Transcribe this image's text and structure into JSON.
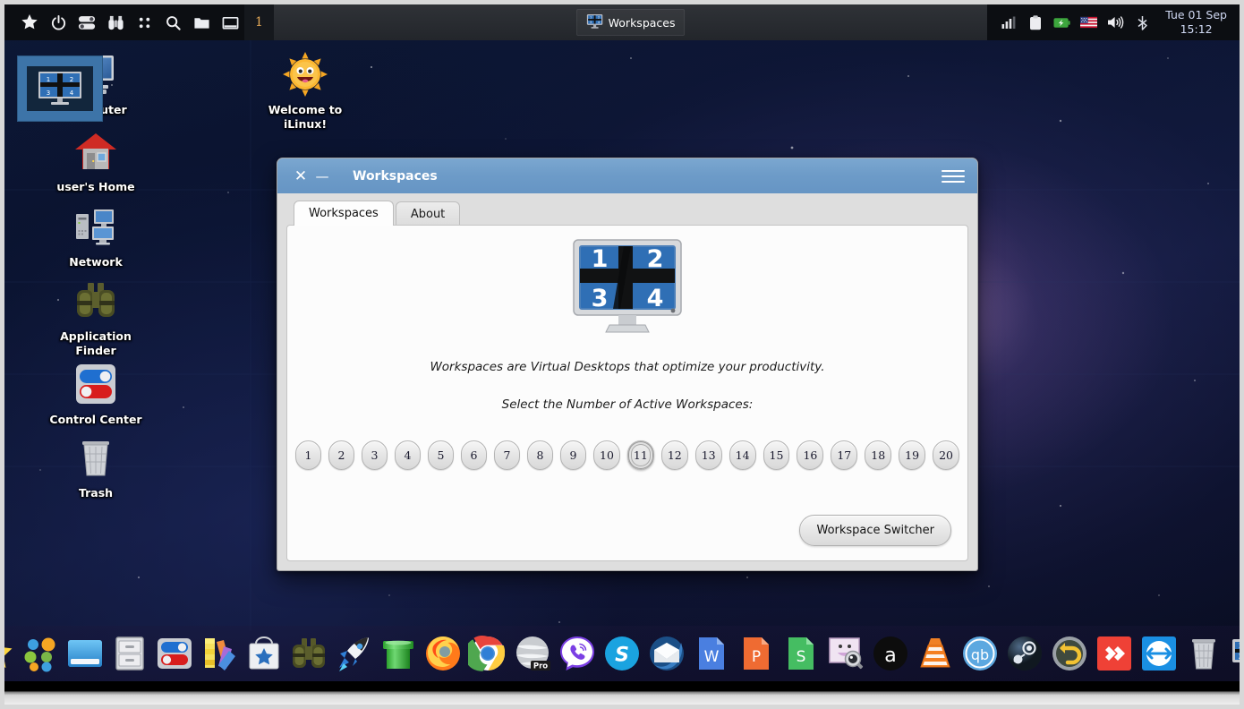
{
  "top_panel": {
    "launchers": [
      {
        "name": "whisker-star-icon",
        "label": "Applications"
      },
      {
        "name": "power-icon",
        "label": "Log Out"
      },
      {
        "name": "toggle-settings-icon",
        "label": "Settings"
      },
      {
        "name": "binoculars-icon",
        "label": "Application Finder"
      },
      {
        "name": "grid-dots-icon",
        "label": "Show Desktop"
      },
      {
        "name": "search-icon",
        "label": "Search"
      },
      {
        "name": "folder-icon",
        "label": "File Manager"
      },
      {
        "name": "window-icon",
        "label": "Terminal"
      }
    ],
    "workspace_number": "1",
    "task_button": {
      "label": "Workspaces",
      "icon": "workspaces-monitor-icon"
    },
    "tray": [
      {
        "name": "network-signal-icon"
      },
      {
        "name": "clipboard-icon"
      },
      {
        "name": "battery-icon"
      },
      {
        "name": "keyboard-flag-us-icon"
      },
      {
        "name": "volume-icon"
      },
      {
        "name": "bluetooth-icon"
      }
    ],
    "clock": {
      "date": "Tue 01 Sep",
      "time": "15:12"
    }
  },
  "desktop_icons": [
    {
      "name": "computer",
      "label": "Computer",
      "icon": "monitor-icon"
    },
    {
      "name": "welcome",
      "label": "Welcome to iLinux!",
      "icon": "sun-smile-icon"
    },
    {
      "name": "home",
      "label": "user's Home",
      "icon": "house-icon"
    },
    {
      "name": "network",
      "label": "Network",
      "icon": "network-computers-icon"
    },
    {
      "name": "appfinder",
      "label": "Application Finder",
      "icon": "binoculars-icon"
    },
    {
      "name": "control-center",
      "label": "Control Center",
      "icon": "toggles-icon"
    },
    {
      "name": "trash",
      "label": "Trash",
      "icon": "trash-bin-icon"
    }
  ],
  "window": {
    "title": "Workspaces",
    "close_label": "✕",
    "minimize_label": "—",
    "menu_label": "☰",
    "tabs": [
      {
        "label": "Workspaces",
        "active": true
      },
      {
        "label": "About",
        "active": false
      }
    ],
    "monitor_numbers": [
      "1",
      "2",
      "3",
      "4"
    ],
    "description": "Workspaces are Virtual Desktops that optimize your productivity.",
    "prompt": "Select the Number of Active Workspaces:",
    "workspace_buttons": [
      "1",
      "2",
      "3",
      "4",
      "5",
      "6",
      "7",
      "8",
      "9",
      "10",
      "11",
      "12",
      "13",
      "14",
      "15",
      "16",
      "17",
      "18",
      "19",
      "20"
    ],
    "selected_workspace": "11",
    "switcher_button": "Workspace Switcher"
  },
  "dock": [
    {
      "name": "whisker-menu",
      "label": "Applications Menu"
    },
    {
      "name": "app-grid",
      "label": "All Applications"
    },
    {
      "name": "window-manager",
      "label": "Window Manager"
    },
    {
      "name": "file-cabinet",
      "label": "Archive Manager"
    },
    {
      "name": "control-center",
      "label": "Control Center"
    },
    {
      "name": "color-palette",
      "label": "Theme Settings"
    },
    {
      "name": "app-store",
      "label": "Software Store"
    },
    {
      "name": "binoculars",
      "label": "Application Finder"
    },
    {
      "name": "rocket",
      "label": "Launcher"
    },
    {
      "name": "green-pipe",
      "label": "Games"
    },
    {
      "name": "firefox",
      "label": "Firefox"
    },
    {
      "name": "chrome",
      "label": "Google Chrome"
    },
    {
      "name": "opera-pro",
      "label": "Opera Pro"
    },
    {
      "name": "viber",
      "label": "Viber"
    },
    {
      "name": "skype",
      "label": "Skype"
    },
    {
      "name": "thunderbird",
      "label": "Thunderbird"
    },
    {
      "name": "writer",
      "label": "Writer"
    },
    {
      "name": "presentation",
      "label": "Presentation"
    },
    {
      "name": "spreadsheet",
      "label": "Spreadsheet"
    },
    {
      "name": "image-viewer",
      "label": "Image Viewer"
    },
    {
      "name": "audacious",
      "label": "Audacious"
    },
    {
      "name": "vlc",
      "label": "VLC Media Player"
    },
    {
      "name": "qbittorrent",
      "label": "qBittorrent"
    },
    {
      "name": "steam",
      "label": "Steam"
    },
    {
      "name": "timeshift",
      "label": "Timeshift"
    },
    {
      "name": "anydesk",
      "label": "AnyDesk"
    },
    {
      "name": "teamviewer",
      "label": "TeamViewer"
    },
    {
      "name": "trash",
      "label": "Trash"
    },
    {
      "name": "workspaces",
      "label": "Workspaces",
      "running": true
    }
  ],
  "colors": {
    "titlebar": "#6d9bc8",
    "panel": "#0c0e12",
    "accent_blue": "#3d74a8",
    "desktop_deep": "#0d1836"
  }
}
